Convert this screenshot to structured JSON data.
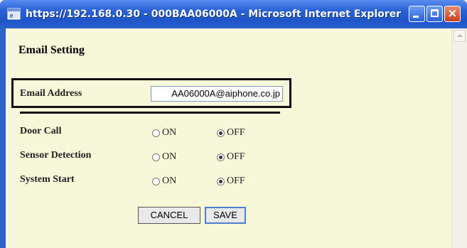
{
  "window": {
    "title": "https://192.168.0.30 - 000BAA06000A - Microsoft Internet Explorer",
    "icon": "ie-icon",
    "controls": [
      "minimize",
      "maximize",
      "close"
    ],
    "close_glyph": "×"
  },
  "page": {
    "heading": "Email Setting",
    "email": {
      "label": "Email Address",
      "value": "AA06000A@aiphone.co.jp"
    },
    "settings": [
      {
        "label": "Door Call",
        "on_label": "ON",
        "off_label": "OFF",
        "selected": "OFF"
      },
      {
        "label": "Sensor Detection",
        "on_label": "ON",
        "off_label": "OFF",
        "selected": "OFF"
      },
      {
        "label": "System Start",
        "on_label": "ON",
        "off_label": "OFF",
        "selected": "OFF"
      }
    ],
    "buttons": {
      "cancel": "CANCEL",
      "save": "SAVE"
    }
  }
}
